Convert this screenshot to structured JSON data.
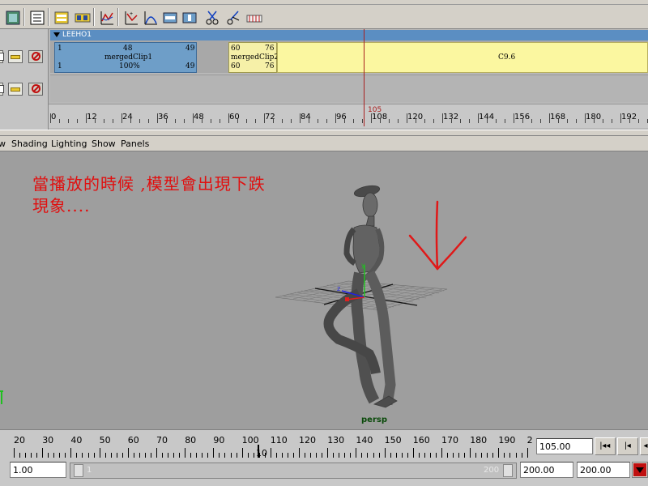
{
  "toolbar": {
    "icons": [
      "outliner-icon",
      "list-icon",
      "clip-library-icon",
      "load-clip-icon",
      "graph-editor-icon",
      "key-icon",
      "curve-icon",
      "add-track-icon",
      "remove-track-icon",
      "cut-icon",
      "split-icon",
      "time-warp-icon"
    ]
  },
  "trax": {
    "character_name": "LEEHO1",
    "clips": [
      {
        "start": "1",
        "end": "48",
        "name": "mergedClip1",
        "scale": "100%",
        "end2": "49",
        "start2": "1",
        "end_right": "49"
      },
      {
        "start": "60",
        "end": "76",
        "name": "mergedClip2",
        "start2": "60",
        "end2": "76"
      },
      {
        "name": "C9.6"
      }
    ],
    "playhead_label": "105",
    "ruler_labels": [
      "0",
      "12",
      "24",
      "36",
      "48",
      "60",
      "72",
      "84",
      "96",
      "108",
      "120",
      "132",
      "144",
      "156",
      "168",
      "180",
      "192"
    ]
  },
  "viewport_menu": {
    "items": [
      "w",
      "Shading",
      "Lighting",
      "Show",
      "Panels"
    ]
  },
  "viewport": {
    "annotation_line1": "當播放的時候 ,模型會出現下跌",
    "annotation_line2": "現象....",
    "camera_label": "persp"
  },
  "timeslider": {
    "labels": [
      "20",
      "30",
      "40",
      "50",
      "60",
      "70",
      "80",
      "90",
      "100",
      "110",
      "120",
      "130",
      "140",
      "150",
      "160",
      "170",
      "180",
      "190",
      "2"
    ],
    "current_frame_marker": "10",
    "current_time": "105.00"
  },
  "range": {
    "start_time": "1.00",
    "start_label": "1",
    "end_label": "200",
    "end_time": "200.00",
    "max_time": "200.00"
  },
  "playback": {
    "prev_key_icon": "step-back-icon",
    "go_start_icon": "go-to-start-icon"
  }
}
